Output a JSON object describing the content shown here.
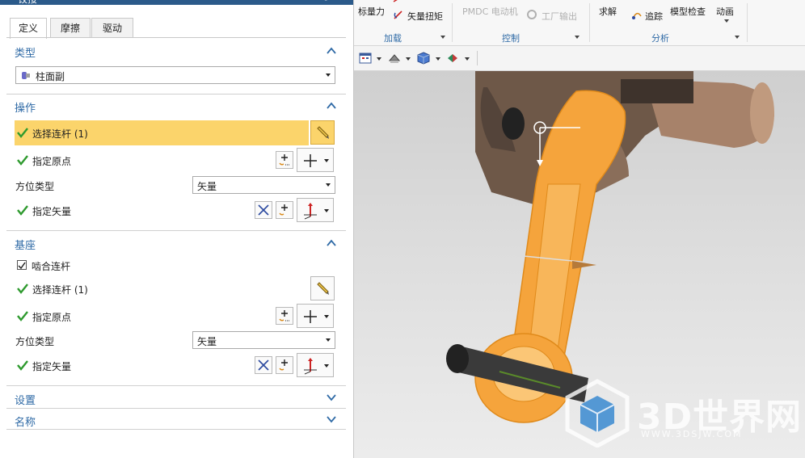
{
  "dialog": {
    "title": "铰接",
    "tabs": [
      "定义",
      "摩擦",
      "驱动"
    ],
    "sections": {
      "type": {
        "title": "类型",
        "value": "柱面副"
      },
      "operation": {
        "title": "操作",
        "select_link": "选择连杆 (1)",
        "specify_origin": "指定原点",
        "orient_type_label": "方位类型",
        "orient_type_value": "矢量",
        "specify_vector": "指定矢量"
      },
      "base": {
        "title": "基座",
        "mesh_link": "啮合连杆",
        "select_link": "选择连杆 (1)",
        "specify_origin": "指定原点",
        "orient_type_label": "方位类型",
        "orient_type_value": "矢量",
        "specify_vector": "指定矢量"
      },
      "settings": {
        "title": "设置"
      },
      "name": {
        "title": "名称"
      }
    }
  },
  "ribbon": {
    "load": {
      "item1": "标量力",
      "item2": "矢量扭矩",
      "group": "加载"
    },
    "control": {
      "item1": "PMDC 电动机",
      "item2": "工厂输出",
      "group": "控制"
    },
    "analysis": {
      "item1": "求解",
      "item2": "追踪",
      "item3": "模型检查",
      "item4": "动画",
      "group": "分析"
    }
  },
  "watermark": {
    "text": "3D世界网",
    "url": "WWW.3DSJW.COM"
  },
  "colors": {
    "accent": "#2f6aa6",
    "highlight": "#fbd46b",
    "check": "#2e9a2e",
    "part": "#f5a43c"
  }
}
